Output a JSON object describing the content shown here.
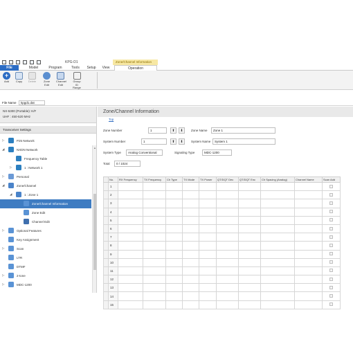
{
  "window": {
    "title_text": "KPG-D1",
    "context_tab": "Zone/Channel Information"
  },
  "ribbon": {
    "tabs": [
      {
        "label": "File"
      },
      {
        "label": "Model"
      },
      {
        "label": "Program"
      },
      {
        "label": "Tools"
      },
      {
        "label": "Setup"
      },
      {
        "label": "View"
      },
      {
        "label": "Operation"
      }
    ],
    "buttons": [
      {
        "label": "Add",
        "icon": "add-icon",
        "disabled": false
      },
      {
        "label": "Copy",
        "icon": "copy-icon",
        "disabled": false
      },
      {
        "label": "Delete",
        "icon": "delete-icon",
        "disabled": true
      },
      {
        "label": "Zone\nEdit",
        "icon": "zone-edit-icon",
        "disabled": false
      },
      {
        "label": "Channel\nEdit",
        "icon": "channel-edit-icon",
        "disabled": false
      },
      {
        "label": "Group ID\nRange",
        "icon": "group-id-range-icon",
        "disabled": false
      }
    ]
  },
  "filebar": {
    "label": "File Name",
    "value": "kpgd1.dat"
  },
  "left_panel": {
    "model": "NX-5300 (Portable): K/F",
    "band": "UHF : 450-520 MHz",
    "title": "Transceiver Settings",
    "tree": [
      {
        "label": "P25 Network",
        "arrow": "▷",
        "icon": "network-icon",
        "depth": 0
      },
      {
        "label": "NXDN Network",
        "arrow": "◢",
        "icon": "network-icon",
        "depth": 0
      },
      {
        "label": "Frequency Table",
        "arrow": "",
        "icon": "network-icon",
        "depth": 1
      },
      {
        "label": "1 : Network 1",
        "arrow": "▷",
        "icon": "network-icon",
        "depth": 1
      },
      {
        "label": "Personal",
        "arrow": "▷",
        "icon": "list-icon",
        "depth": 0
      },
      {
        "label": "Zone/Channel",
        "arrow": "◢",
        "icon": "zone-icon",
        "depth": 0
      },
      {
        "label": "1 : Zone 1",
        "arrow": "◢",
        "icon": "zone-icon",
        "depth": 1
      },
      {
        "label": "Zone/Channel Information",
        "arrow": "",
        "icon": "gear-icon",
        "depth": 2,
        "selected": true
      },
      {
        "label": "Zone Edit",
        "arrow": "",
        "icon": "gear-icon",
        "depth": 2
      },
      {
        "label": "Channel Edit",
        "arrow": "",
        "icon": "channel-icon",
        "depth": 2
      },
      {
        "label": "Optional Features",
        "arrow": "▷",
        "icon": "gear-icon",
        "depth": 0
      },
      {
        "label": "Key Assignment",
        "arrow": "",
        "icon": "gear-icon",
        "depth": 0
      },
      {
        "label": "Scan",
        "arrow": "▷",
        "icon": "gear-icon",
        "depth": 0
      },
      {
        "label": "LTR",
        "arrow": "",
        "icon": "gear-icon",
        "depth": 0
      },
      {
        "label": "DTMF",
        "arrow": "",
        "icon": "gear-icon",
        "depth": 0
      },
      {
        "label": "2-tone",
        "arrow": "▷",
        "icon": "gear-icon",
        "depth": 0
      },
      {
        "label": "MDC-1200",
        "arrow": "▷",
        "icon": "gear-icon",
        "depth": 0
      }
    ]
  },
  "content": {
    "title": "Zone/Channel Information",
    "top_link": "Top",
    "zone_number_label": "Zone Number",
    "zone_number": "1",
    "zone_name_label": "Zone Name",
    "zone_name": "Zone 1",
    "system_number_label": "System Number",
    "system_number": "1",
    "system_name_label": "System Name",
    "system_name": "System 1",
    "system_type_label": "System Type",
    "system_type": "Analog Conventional",
    "signaling_type_label": "Signaling Type",
    "signaling_type": "MDC-1200",
    "total_label": "Total",
    "total_value": "0 / 1024"
  },
  "grid": {
    "columns": [
      "No.",
      "RX Frequency",
      "TX Frequency",
      "Ch Type",
      "TX Mode",
      "TX Power",
      "QT/DQT Dec",
      "QT/DQT Enc",
      "Ch Spacing (Analog)",
      "Channel Name",
      "Scan Add"
    ],
    "rows": [
      "1",
      "2",
      "3",
      "4",
      "5",
      "6",
      "7",
      "8",
      "9",
      "10",
      "11",
      "12",
      "13",
      "14",
      "15"
    ]
  },
  "colors": {
    "accent": "#2b6cc4",
    "selected": "#3e7cc2",
    "context_tab": "#f7e8a3"
  }
}
